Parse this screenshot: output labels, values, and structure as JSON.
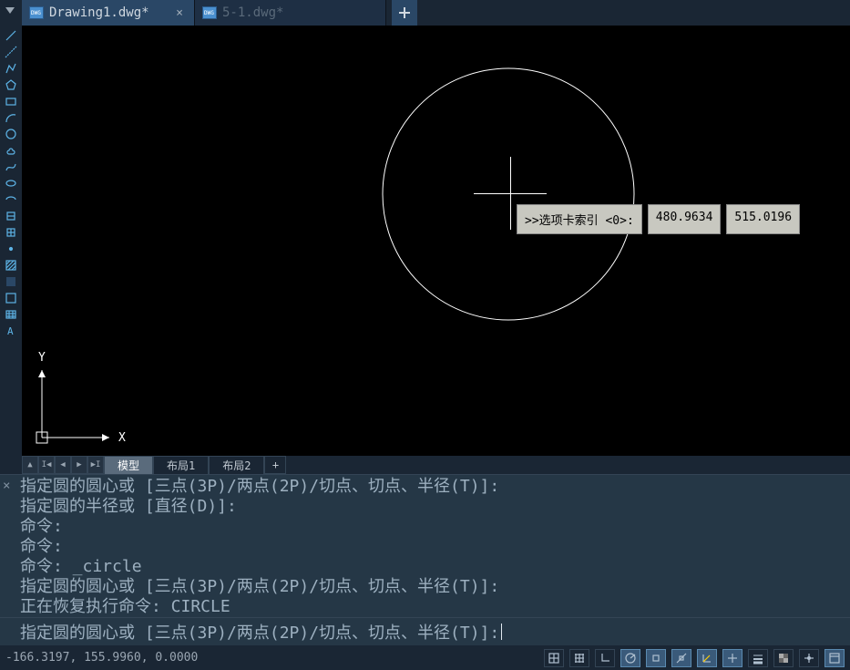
{
  "tabs": [
    {
      "label": "Drawing1.dwg*",
      "active": true
    },
    {
      "label": "5-1.dwg*",
      "active": false
    }
  ],
  "canvas": {
    "cursor_prompt": ">>选项卡索引 <0>:",
    "cursor_x": "480.9634",
    "cursor_y": "515.0196",
    "ucs": {
      "x_label": "X",
      "y_label": "Y"
    }
  },
  "layout_tabs": {
    "model": "模型",
    "layout1": "布局1",
    "layout2": "布局2",
    "plus": "+"
  },
  "command": {
    "history": [
      "指定圆的圆心或 [三点(3P)/两点(2P)/切点、切点、半径(T)]:",
      "指定圆的半径或 [直径(D)]:",
      "命令:",
      "命令:",
      "命令: _circle",
      "指定圆的圆心或 [三点(3P)/两点(2P)/切点、切点、半径(T)]:",
      "正在恢复执行命令: CIRCLE"
    ],
    "prompt": "指定圆的圆心或 [三点(3P)/两点(2P)/切点、切点、半径(T)]: "
  },
  "status": {
    "coords": "-166.3197, 155.9960, 0.0000"
  },
  "tool_names": [
    "line-tool",
    "construction-line-tool",
    "polyline-tool",
    "polygon-tool",
    "rectangle-tool",
    "arc-tool",
    "circle-tool",
    "revcloud-tool",
    "spline-tool",
    "ellipse-tool",
    "ellipse-arc-tool",
    "insert-block-tool",
    "make-block-tool",
    "point-tool",
    "hatch-tool",
    "gradient-tool",
    "region-tool",
    "table-tool",
    "mtext-tool"
  ],
  "status_toggles": [
    "snap-grid-icon",
    "grid-display-icon",
    "ortho-icon",
    "polar-icon",
    "osnap-icon",
    "otrack-icon",
    "ducs-icon",
    "dyn-icon",
    "lineweight-icon",
    "transparency-icon",
    "sel-cycling-icon",
    "quick-props-icon"
  ]
}
